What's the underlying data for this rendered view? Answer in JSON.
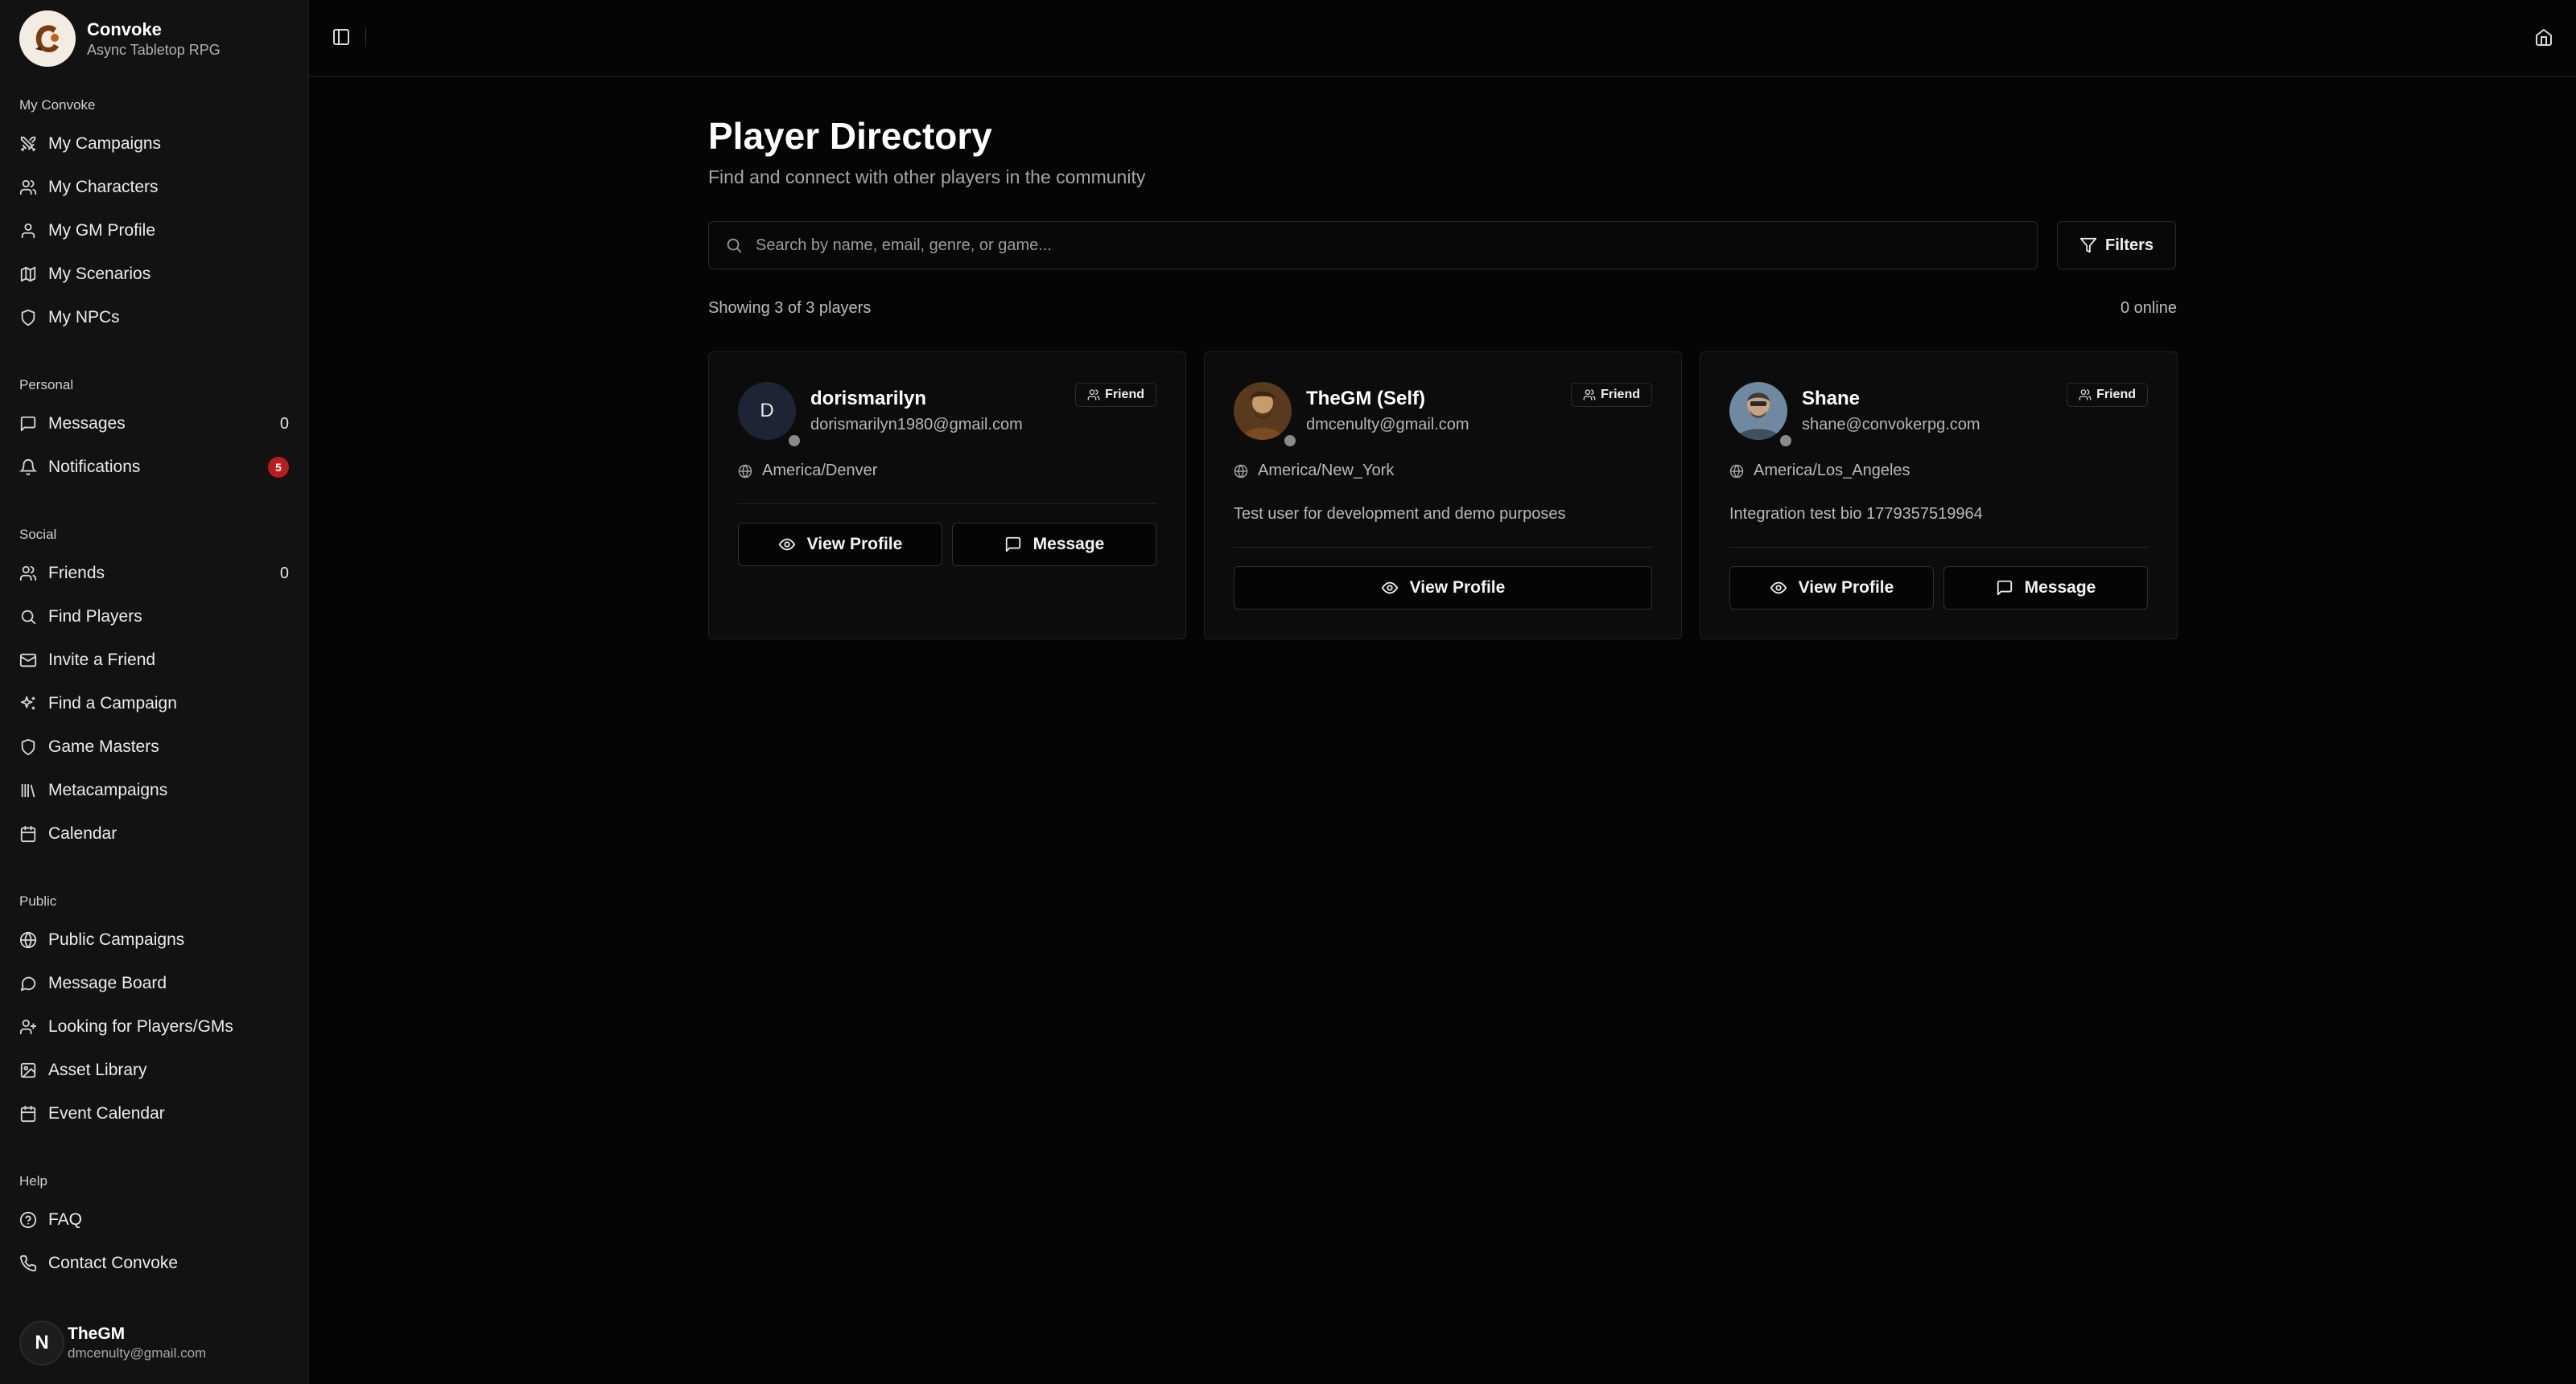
{
  "brand": {
    "name": "Convoke",
    "subtitle": "Async Tabletop RPG"
  },
  "sidebar": {
    "sections": [
      {
        "heading": "My Convoke",
        "items": [
          {
            "label": "My Campaigns",
            "icon": "swords-icon"
          },
          {
            "label": "My Characters",
            "icon": "users-icon"
          },
          {
            "label": "My GM Profile",
            "icon": "user-icon"
          },
          {
            "label": "My Scenarios",
            "icon": "map-icon"
          },
          {
            "label": "My NPCs",
            "icon": "shield-icon"
          }
        ]
      },
      {
        "heading": "Personal",
        "items": [
          {
            "label": "Messages",
            "icon": "message-icon",
            "count": "0"
          },
          {
            "label": "Notifications",
            "icon": "bell-icon",
            "badge": "5"
          }
        ]
      },
      {
        "heading": "Social",
        "items": [
          {
            "label": "Friends",
            "icon": "users-icon",
            "count": "0"
          },
          {
            "label": "Find Players",
            "icon": "search-icon"
          },
          {
            "label": "Invite a Friend",
            "icon": "mail-icon"
          },
          {
            "label": "Find a Campaign",
            "icon": "sparkles-icon"
          },
          {
            "label": "Game Masters",
            "icon": "shield-icon"
          },
          {
            "label": "Metacampaigns",
            "icon": "library-icon"
          },
          {
            "label": "Calendar",
            "icon": "calendar-icon"
          }
        ]
      },
      {
        "heading": "Public",
        "items": [
          {
            "label": "Public Campaigns",
            "icon": "globe-icon"
          },
          {
            "label": "Message Board",
            "icon": "message-circle-icon"
          },
          {
            "label": "Looking for Players/GMs",
            "icon": "user-plus-icon"
          },
          {
            "label": "Asset Library",
            "icon": "image-icon"
          },
          {
            "label": "Event Calendar",
            "icon": "calendar-icon"
          }
        ]
      },
      {
        "heading": "Help",
        "items": [
          {
            "label": "FAQ",
            "icon": "help-circle-icon"
          },
          {
            "label": "Contact Convoke",
            "icon": "phone-icon"
          }
        ]
      }
    ]
  },
  "user": {
    "initial": "N",
    "name": "TheGM",
    "email": "dmcenulty@gmail.com"
  },
  "page": {
    "title": "Player Directory",
    "subtitle": "Find and connect with other players in the community",
    "search_placeholder": "Search by name, email, genre, or game...",
    "filters_label": "Filters",
    "showing_text": "Showing 3 of 3 players",
    "online_text": "0 online"
  },
  "players": [
    {
      "name": "dorismarilyn",
      "email": "dorismarilyn1980@gmail.com",
      "initial": "D",
      "badge": "Friend",
      "timezone": "America/Denver",
      "bio": "",
      "actions": [
        "View Profile",
        "Message"
      ]
    },
    {
      "name": "TheGM (Self)",
      "email": "dmcenulty@gmail.com",
      "initial": "",
      "badge": "Friend",
      "timezone": "America/New_York",
      "bio": "Test user for development and demo purposes",
      "actions": [
        "View Profile"
      ]
    },
    {
      "name": "Shane",
      "email": "shane@convokerpg.com",
      "initial": "",
      "badge": "Friend",
      "timezone": "America/Los_Angeles",
      "bio": "Integration test bio 1779357519964",
      "actions": [
        "View Profile",
        "Message"
      ]
    }
  ]
}
